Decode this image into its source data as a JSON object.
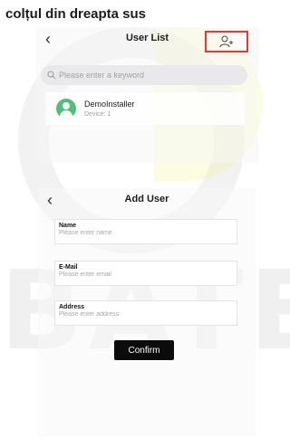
{
  "caption": "colțul din dreapta sus",
  "user_list": {
    "back": "‹",
    "title": "User List",
    "search_placeholder": "Please enter a keyword",
    "users": [
      {
        "name": "DemoInstaller",
        "devices": "Device: 1"
      }
    ]
  },
  "add_user": {
    "back": "‹",
    "title": "Add User",
    "fields": [
      {
        "label": "Name",
        "placeholder": "Please enter name"
      },
      {
        "label": "E-Mail",
        "placeholder": "Please enter email"
      },
      {
        "label": "Address",
        "placeholder": "Please enter address"
      }
    ],
    "confirm": "Confirm"
  },
  "watermark": "BATEM",
  "colors": {
    "highlight": "#e53935",
    "avatar": "#4fbf7a",
    "button": "#0b0b0b"
  },
  "icons": {
    "add_user": "person-plus-icon",
    "search": "search-icon",
    "back": "chevron-left-icon"
  }
}
